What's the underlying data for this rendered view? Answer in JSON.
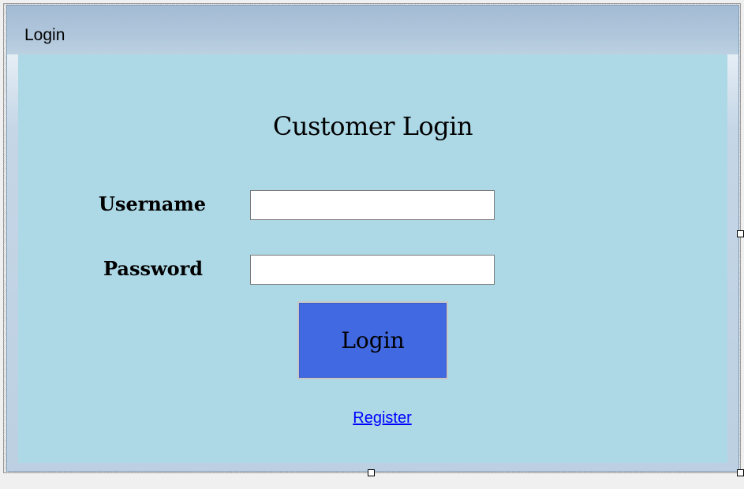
{
  "window": {
    "title": "Login"
  },
  "form": {
    "heading": "Customer Login",
    "username_label": "Username",
    "username_value": "",
    "password_label": "Password",
    "password_value": "",
    "login_button_label": "Login",
    "register_link_label": "Register"
  },
  "colors": {
    "client_background": "#add8e6",
    "login_button": "#4169e1",
    "link": "#0000ff"
  }
}
